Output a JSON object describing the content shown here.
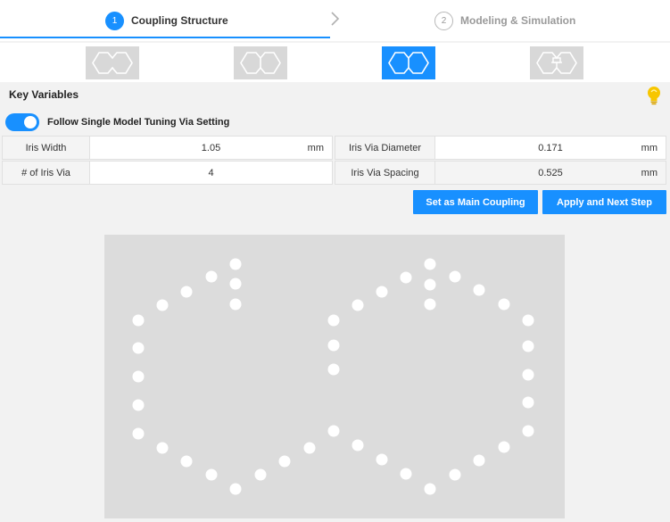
{
  "stepper": {
    "steps": [
      {
        "number": "1",
        "label": "Coupling Structure",
        "active": true
      },
      {
        "number": "2",
        "label": "Modeling & Simulation",
        "active": false
      }
    ]
  },
  "thumbnails": [
    {
      "icon": "hexagon-pair-icon",
      "selected": false
    },
    {
      "icon": "hexagon-pair-joined-icon",
      "selected": false
    },
    {
      "icon": "hexagon-pair-joined-icon",
      "selected": true
    },
    {
      "icon": "hexagon-pair-split-icon",
      "selected": false
    }
  ],
  "key_variables": {
    "title": "Key Variables",
    "hint_icon": "lightbulb-icon",
    "toggle": {
      "label": "Follow Single Model Tuning Via Setting",
      "on": true
    },
    "fields": [
      {
        "label": "Iris Width",
        "value": "1.05",
        "unit": "mm"
      },
      {
        "label": "Iris Via Diameter",
        "value": "0.171",
        "unit": "mm"
      },
      {
        "label": "# of Iris Via",
        "value": "4",
        "unit": ""
      },
      {
        "label": "Iris Via Spacing",
        "value": "0.525",
        "unit": "mm"
      }
    ]
  },
  "actions": {
    "set_main": "Set as Main Coupling",
    "apply_next": "Apply and Next Step"
  },
  "colors": {
    "accent": "#1890ff",
    "via": "#ffffff",
    "diagram_bg": "#dcdcdc",
    "bulb": "#f7c600"
  }
}
